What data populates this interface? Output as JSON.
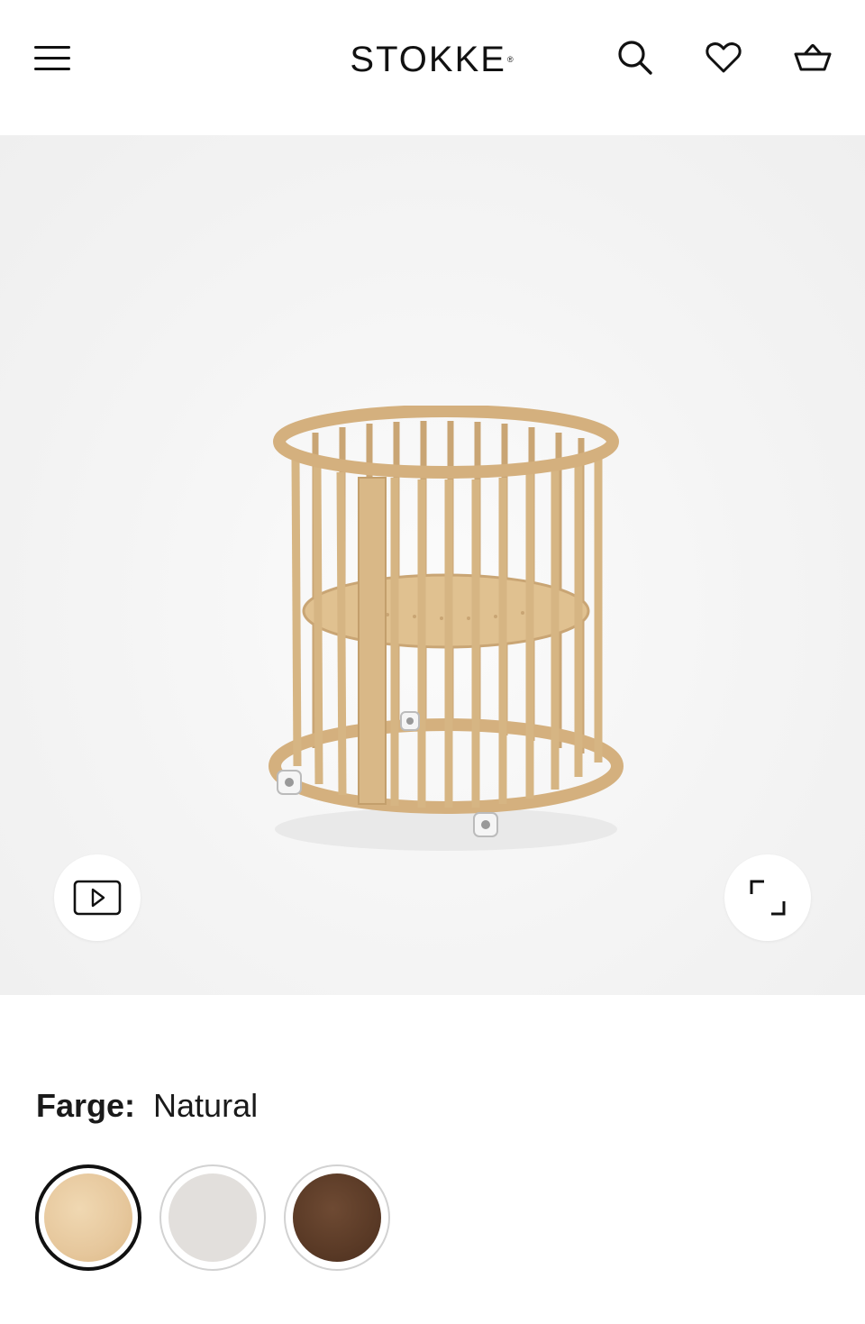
{
  "header": {
    "logo_text": "STOKKE",
    "logo_mark": "®",
    "icons": [
      "menu-icon",
      "search-icon",
      "heart-icon",
      "basket-icon"
    ]
  },
  "gallery": {
    "video_icon": "play-icon",
    "expand_icon": "expand-icon"
  },
  "color_selector": {
    "label": "Farge:",
    "selected_value": "Natural",
    "swatches": [
      {
        "color": "#e6c79c",
        "selected": true
      },
      {
        "color": "#e2dfdc",
        "selected": false
      },
      {
        "color": "#5a3a26",
        "selected": false
      }
    ]
  }
}
